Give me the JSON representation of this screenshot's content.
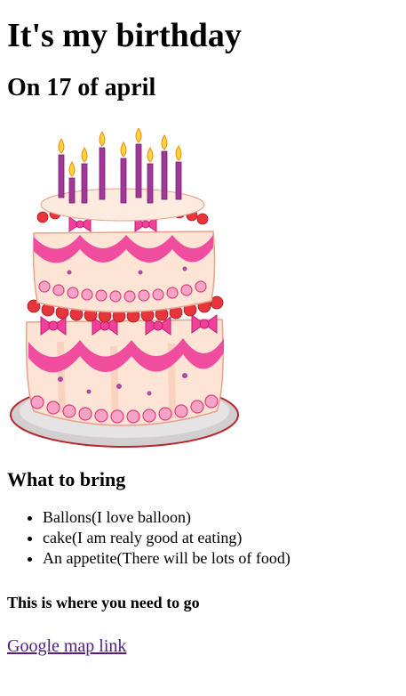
{
  "page": {
    "title": "It's my birthday",
    "date_heading": "On 17 of april",
    "image": {
      "subject": "birthday-cake",
      "candle_count": 9,
      "colors": {
        "frosting_pink": "#f0409a",
        "cake_cream": "#fde4d4",
        "cherry_red": "#e8343c",
        "plate_gray": "#c8c4c6",
        "candle_purple": "#a0389a",
        "flame_yellow": "#fbd43a"
      }
    },
    "bring_heading": "What to bring",
    "bring_items": [
      "Ballons(I love balloon)",
      "cake(I am realy good at eating)",
      "An appetite(There will be lots of food)"
    ],
    "location_heading": "This is where you need to go",
    "map_link_label": "Google map link",
    "link_color": "#551a8b"
  }
}
